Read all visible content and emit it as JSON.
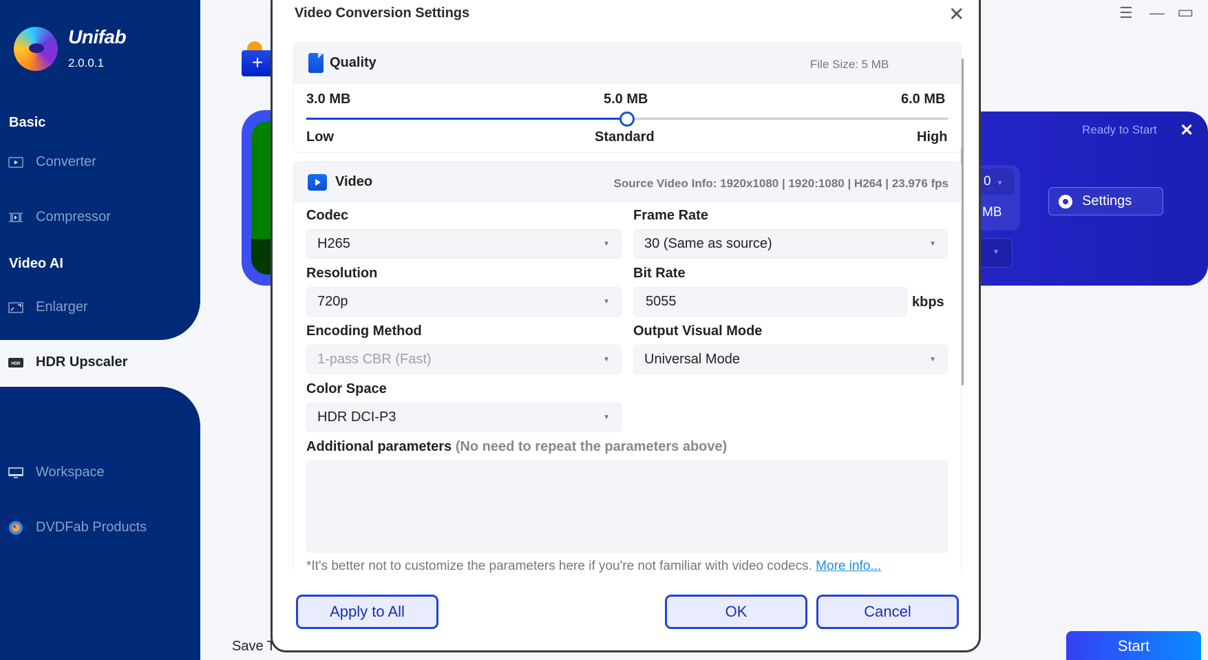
{
  "app": {
    "brand": "Unifab",
    "version": "2.0.0.1"
  },
  "sidebar": {
    "sections": [
      {
        "label": "Basic"
      },
      {
        "label": "Video AI"
      }
    ],
    "items": [
      {
        "label": "Converter",
        "icon": "play-box-icon"
      },
      {
        "label": "Compressor",
        "icon": "compress-icon"
      },
      {
        "label": "Enlarger",
        "icon": "enlarge-icon"
      },
      {
        "label": "HDR Upscaler",
        "icon": "hdr-icon",
        "active": true
      },
      {
        "label": "Workspace",
        "icon": "monitor-icon"
      },
      {
        "label": "DVDFab Products",
        "icon": "dvdfab-icon"
      }
    ]
  },
  "window_controls": {
    "menu": "☰",
    "minimize": "—",
    "maximize": "▭"
  },
  "background": {
    "add_button": "+",
    "task_status": "Ready to Start",
    "task_close": "✕",
    "output_select_value": "0",
    "size_text": "MB",
    "settings_label": "Settings",
    "save_to_label": "Save T",
    "start_label": "Start"
  },
  "dialog": {
    "title": "Video Conversion Settings",
    "close": "✕",
    "quality": {
      "title": "Quality",
      "file_size": "File Size:   5 MB",
      "slider": {
        "min_value_label": "3.0 MB",
        "current_value_label": "5.0 MB",
        "max_value_label": "6.0 MB",
        "low_label": "Low",
        "standard_label": "Standard",
        "high_label": "High",
        "value_fraction": 0.5
      }
    },
    "video": {
      "title": "Video",
      "source_info": "Source Video Info: 1920x1080 | 1920:1080 | H264 | 23.976 fps",
      "codec": {
        "label": "Codec",
        "value": "H265"
      },
      "frame_rate": {
        "label": "Frame Rate",
        "value": "30 (Same as source)"
      },
      "resolution": {
        "label": "Resolution",
        "value": "720p"
      },
      "bit_rate": {
        "label": "Bit Rate",
        "value": "5055",
        "unit": "kbps"
      },
      "encoding_method": {
        "label": "Encoding Method",
        "value": "1-pass CBR (Fast)",
        "disabled": true
      },
      "output_visual_mode": {
        "label": "Output Visual Mode",
        "value": "Universal Mode"
      },
      "color_space": {
        "label": "Color Space",
        "value": "HDR DCI-P3"
      },
      "additional": {
        "label": "Additional parameters",
        "hint": "(No need to repeat the parameters above)",
        "value": ""
      },
      "note": "*It's better not to customize the parameters here if you're not familiar with video codecs.",
      "more_info": "More info..."
    },
    "buttons": {
      "apply_all": "Apply to All",
      "ok": "OK",
      "cancel": "Cancel"
    }
  }
}
